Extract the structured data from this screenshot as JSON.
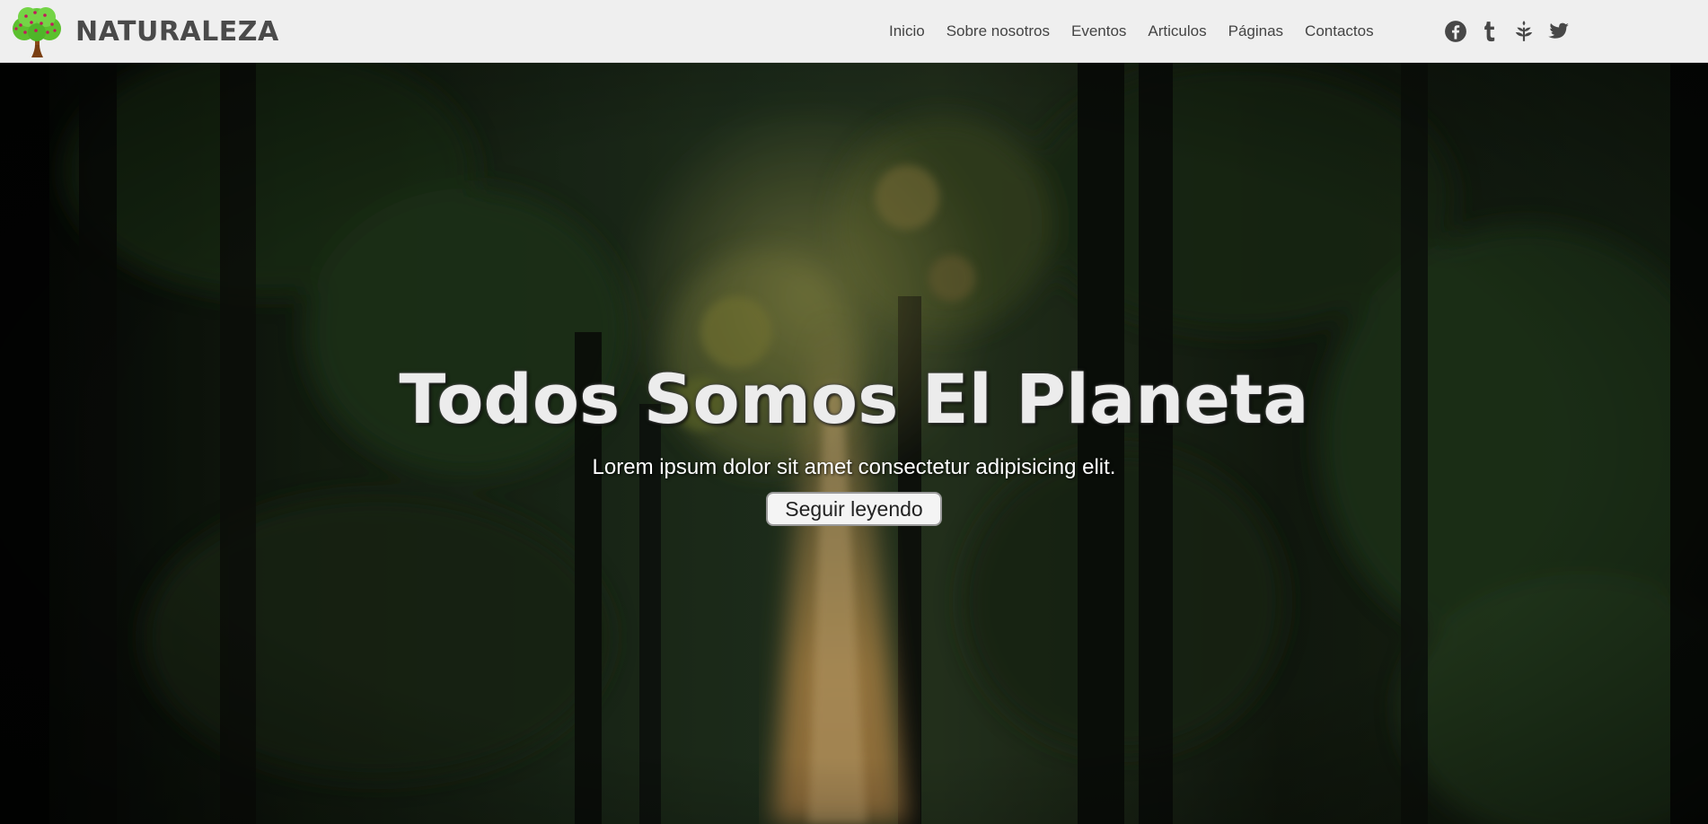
{
  "header": {
    "brand": "NATURALEZA",
    "logo_icon": "tree-icon",
    "nav": [
      {
        "label": "Inicio"
      },
      {
        "label": "Sobre nosotros"
      },
      {
        "label": "Eventos"
      },
      {
        "label": "Articulos"
      },
      {
        "label": "Páginas"
      },
      {
        "label": "Contactos"
      }
    ],
    "social_icons": [
      "facebook-icon",
      "tumblr-icon",
      "leaf-icon",
      "twitter-icon"
    ]
  },
  "hero": {
    "title": "Todos Somos El Planeta",
    "subtitle": "Lorem ipsum dolor sit amet consectetur adipisicing elit.",
    "button": "Seguir leyendo",
    "background": "forest-photo"
  },
  "colors": {
    "navbar_bg": "#efefef",
    "text_dark": "#444444",
    "brand_text": "#4a4a4a",
    "title_text": "#ececec",
    "forest_dark": "#0d130c",
    "light_ray": "#c9a05a"
  }
}
